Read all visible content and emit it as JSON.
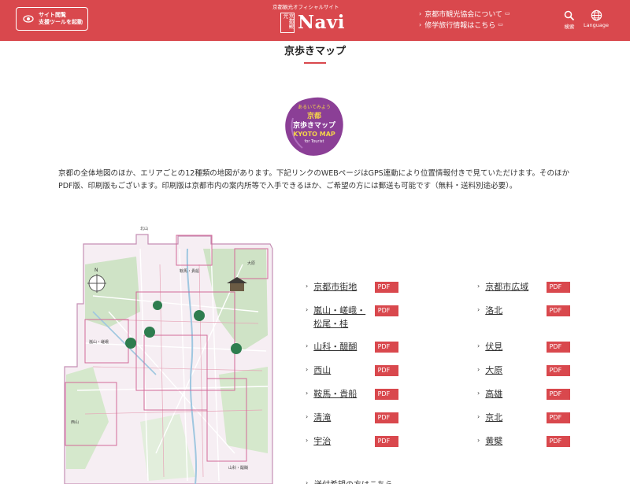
{
  "header": {
    "a11y_button": "サイト閲覧\n支援ツールを起動",
    "brand_sub": "京都観光オフィシャルサイト",
    "brand_seal": "京都観光",
    "brand_name": "Navi",
    "links": [
      {
        "label": "京都市観光協会について"
      },
      {
        "label": "修学旅行情報はこちら"
      }
    ],
    "search_label": "検索",
    "language_label": "Language"
  },
  "page": {
    "title": "京歩きマップ",
    "logo": {
      "top_text": "あるいてみよう",
      "line1": "京都",
      "line2": "京歩きマップ",
      "line3": "KYOTO MAP",
      "line4": "for Tourist"
    },
    "intro": "京都の全体地図のほか、エリアごとの12種類の地図があります。下記リンクのWEBページはGPS連動により位置情報付きで見ていただけます。そのほかPDF版、印刷版もございます。印刷版は京都市内の案内所等で入手できるほか、ご希望の方には郵送も可能です（無料・送料別途必要）。"
  },
  "map_labels": {
    "kurama": "鞍馬・貴船",
    "kitayama": "北山",
    "arashiyama": "嵐山・嵯峨",
    "nishiyama": "西山",
    "ohara": "大原",
    "yamashina": "山科・醍醐"
  },
  "pdf_label": "PDF版",
  "left_links": [
    {
      "name": "京都市街地"
    },
    {
      "name": "嵐山・嵯峨・松尾・桂"
    },
    {
      "name": "山科・醍醐"
    },
    {
      "name": "西山"
    },
    {
      "name": "鞍馬・貴船"
    },
    {
      "name": "清滝"
    },
    {
      "name": "宇治"
    }
  ],
  "right_links": [
    {
      "name": "京都市広域"
    },
    {
      "name": "洛北"
    },
    {
      "name": "伏見"
    },
    {
      "name": "大原"
    },
    {
      "name": "高雄"
    },
    {
      "name": "京北"
    },
    {
      "name": "黄檗"
    }
  ],
  "bottom_link": "送付希望の方はこちら",
  "colors": {
    "accent": "#d9484d",
    "logo_purple": "#8b3f96"
  }
}
